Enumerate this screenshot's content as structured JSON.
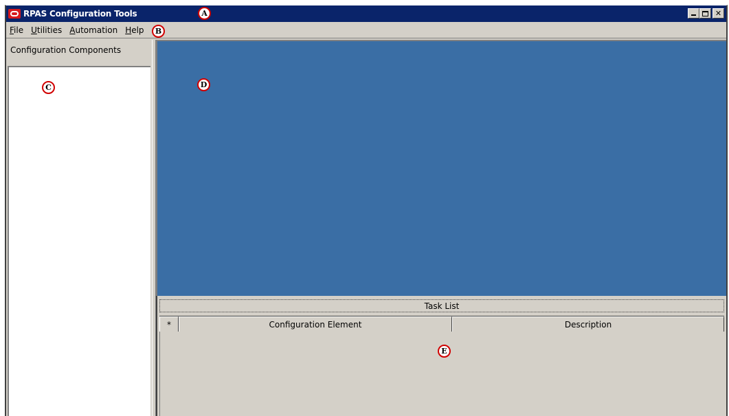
{
  "window": {
    "title": "RPAS Configuration Tools",
    "buttons": {
      "minimize": "_",
      "maximize": "□",
      "close": "✕"
    }
  },
  "menu": {
    "items": [
      {
        "label": "File",
        "accel": "F",
        "rest": "ile"
      },
      {
        "label": "Utilities",
        "accel": "U",
        "rest": "tilities"
      },
      {
        "label": "Automation",
        "accel": "A",
        "rest": "utomation"
      },
      {
        "label": "Help",
        "accel": "H",
        "rest": "elp"
      }
    ]
  },
  "left_panel": {
    "header": "Configuration Components"
  },
  "task_list": {
    "title": "Task List",
    "columns": [
      "*",
      "Configuration Element",
      "Description"
    ]
  },
  "markers": [
    "A",
    "B",
    "C",
    "D",
    "E"
  ],
  "colors": {
    "titlebar": "#0a246a",
    "workspace": "#3a6ea5",
    "chrome": "#d4d0c8",
    "marker_ring": "#d10000"
  }
}
